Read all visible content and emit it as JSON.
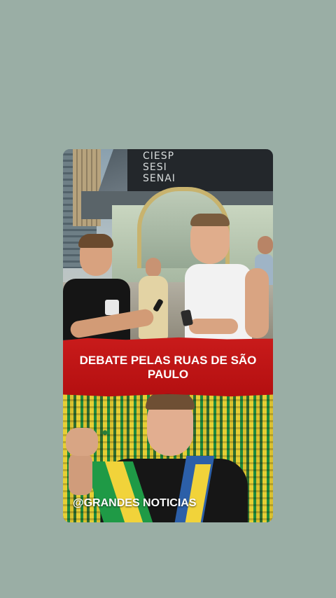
{
  "story": {
    "sign_lines": [
      "CIESP",
      "SESI",
      "SENAI"
    ],
    "banner_title": "DEBATE PELAS RUAS DE SÃO PAULO",
    "watermark": "@GRANDES NOTICIAS"
  },
  "colors": {
    "background": "#9aaea5",
    "banner_red": "#c91b1b",
    "banner_text": "#ffffff"
  }
}
